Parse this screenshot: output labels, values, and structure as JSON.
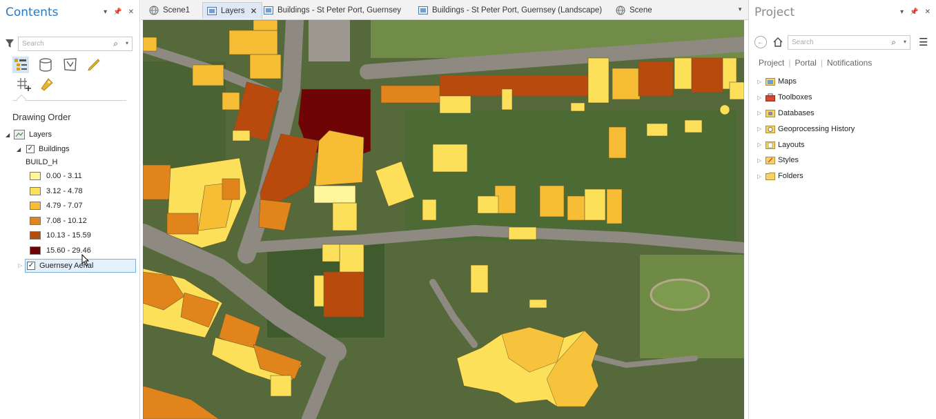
{
  "contents": {
    "title": "Contents",
    "search_placeholder": "Search",
    "drawing_order": "Drawing Order",
    "layers_group": "Layers",
    "buildings_layer": "Buildings",
    "field": "BUILD_H",
    "legend": [
      {
        "label": "0.00 - 3.11",
        "color": "#fff59a"
      },
      {
        "label": "3.12 - 4.78",
        "color": "#fde05a"
      },
      {
        "label": "4.79 - 7.07",
        "color": "#f6bd35"
      },
      {
        "label": "7.08 - 10.12",
        "color": "#e2841c"
      },
      {
        "label": "10.13 - 15.59",
        "color": "#b84a0d"
      },
      {
        "label": "15.60 - 29.46",
        "color": "#6e0406"
      }
    ],
    "aerial_layer": "Guernsey Aerial"
  },
  "tabs": [
    {
      "label": "Scene1",
      "icon": "globe-icon"
    },
    {
      "label": "Layers",
      "icon": "map-icon",
      "active": true
    },
    {
      "label": "Buildings - St Peter Port, Guernsey",
      "icon": "map-icon"
    },
    {
      "label": "Buildings - St Peter Port, Guernsey (Landscape)",
      "icon": "map-icon"
    },
    {
      "label": "Scene",
      "icon": "globe-icon"
    }
  ],
  "project": {
    "title": "Project",
    "search_placeholder": "Search",
    "tabs": [
      "Project",
      "Portal",
      "Notifications"
    ],
    "items": [
      "Maps",
      "Toolboxes",
      "Databases",
      "Geoprocessing History",
      "Layouts",
      "Styles",
      "Folders"
    ]
  },
  "colors": {
    "accent": "#2a78c4",
    "road": "#8e8a82",
    "vegetation": "#4d6a30"
  }
}
